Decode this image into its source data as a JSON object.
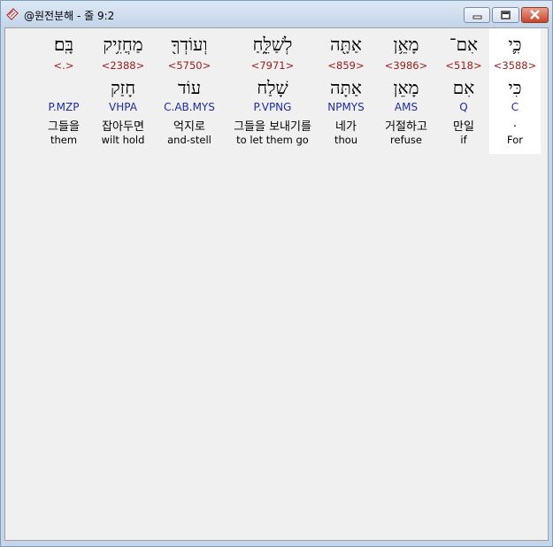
{
  "window": {
    "title": "@원전분해 - 줄 9:2",
    "icons": {
      "app": "bible-book-icon",
      "minimize": "minimize-icon",
      "maximize": "maximize-icon",
      "close": "close-icon"
    }
  },
  "columns": [
    {
      "hebrew_top": "בָּֽם׃",
      "strongs": "<.>",
      "hebrew_bottom": "",
      "morph": "P.MZP",
      "korean": "그들을",
      "english": "them"
    },
    {
      "hebrew_top": "מַחֲזִ֥יק",
      "strongs": "<2388>",
      "hebrew_bottom": "חָזַק",
      "morph": "VHPA",
      "korean": "잡아두면",
      "english": "wilt hold"
    },
    {
      "hebrew_top": "וְעוֹדְךָ֖",
      "strongs": "<5750>",
      "hebrew_bottom": "עוֹד",
      "morph": "C.AB.MYS",
      "korean": "억지로",
      "english": "and-stell"
    },
    {
      "hebrew_top": "לְשַׁלֵּ֑חַ",
      "strongs": "<7971>",
      "hebrew_bottom": "שָׁלַח",
      "morph": "P.VPNG",
      "korean": "그들을 보내기를",
      "english": "to let them go"
    },
    {
      "hebrew_top": "אַתָּ֖ה",
      "strongs": "<859>",
      "hebrew_bottom": "אַתָּה",
      "morph": "NPMYS",
      "korean": "네가",
      "english": "thou"
    },
    {
      "hebrew_top": "מָאֵ֥ן",
      "strongs": "<3986>",
      "hebrew_bottom": "מָאֵן",
      "morph": "AMS",
      "korean": "거절하고",
      "english": "refuse"
    },
    {
      "hebrew_top": "אִם־",
      "strongs": "<518>",
      "hebrew_bottom": "אִם",
      "morph": "Q",
      "korean": "만일",
      "english": "if"
    },
    {
      "hebrew_top": "כִּ֛י",
      "strongs": "<3588>",
      "hebrew_bottom": "כִּי",
      "morph": "C",
      "korean": ".",
      "english": "For"
    }
  ]
}
